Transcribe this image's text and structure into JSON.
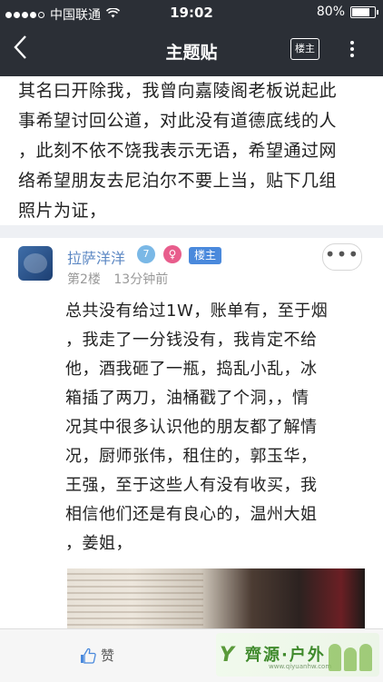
{
  "status_bar": {
    "carrier": "中国联通",
    "time": "19:02",
    "battery_percent": "80%",
    "battery_level": 0.8,
    "signal_bars_filled": 4
  },
  "nav": {
    "title": "主题贴",
    "owner_button": "楼主"
  },
  "post": {
    "lines": [
      "其名曰开除我，我曾向嘉陵阁老板说起此",
      "事希望讨回公道，对此没有道德底线的人",
      "，此刻不依不饶我表示无语，希望通过网",
      "络希望朋友去尼泊尔不要上当，贴下几组",
      "照片为证，"
    ]
  },
  "reply": {
    "username": "拉萨洋洋",
    "level": "7",
    "gender_symbol": "♀",
    "owner_badge": "楼主",
    "floor": "第2楼",
    "time_ago": "13分钟前",
    "more_symbol": "•••",
    "lines": [
      "总共没有给过1W，账单有，至于烟",
      "，我走了一分钱没有，我肯定不给",
      "他，酒我砸了一瓶，捣乱小乱，冰",
      "箱插了两刀，油桶戳了个洞，，情",
      "况其中很多认识他的朋友都了解情",
      "况，厨师张伟，租住的，郭玉华，",
      "王强，至于这些人有没有收买，我",
      "相信他们还是有良心的，温州大姐",
      "，姜姐，"
    ]
  },
  "bottom_bar": {
    "like_label": "赞",
    "watermark_text": "齊源·户外",
    "watermark_url": "www.qiyuanhw.com"
  },
  "colors": {
    "header_bg": "#2b2f36",
    "username": "#5b87c3",
    "owner_badge": "#4a89dc",
    "gender_badge": "#e85d8c",
    "level_badge": "#7ab8e6"
  }
}
